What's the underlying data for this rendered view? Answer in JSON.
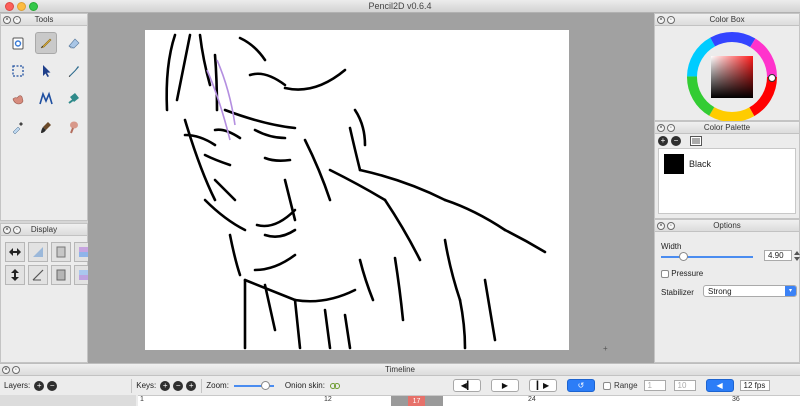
{
  "window": {
    "title": "Pencil2D v0.6.4"
  },
  "tools": {
    "title": "Tools",
    "items": [
      {
        "name": "clear-icon"
      },
      {
        "name": "pencil-icon"
      },
      {
        "name": "eraser-icon"
      },
      {
        "name": "select-icon"
      },
      {
        "name": "pointer-icon"
      },
      {
        "name": "pen-icon"
      },
      {
        "name": "hand-icon"
      },
      {
        "name": "polyline-icon"
      },
      {
        "name": "bucket-icon"
      },
      {
        "name": "eyedropper-icon"
      },
      {
        "name": "brush-icon"
      },
      {
        "name": "smudge-icon"
      }
    ],
    "active": "pencil-icon"
  },
  "display": {
    "title": "Display"
  },
  "colorbox": {
    "title": "Color Box"
  },
  "palette": {
    "title": "Color Palette",
    "colors": [
      {
        "name": "Black",
        "hex": "#000000"
      }
    ]
  },
  "options": {
    "title": "Options",
    "width_label": "Width",
    "width_value": "4.90",
    "pressure_label": "Pressure",
    "stabilizer_label": "Stabilizer",
    "stabilizer_value": "Strong"
  },
  "timeline": {
    "title": "Timeline",
    "layers_label": "Layers:",
    "keys_label": "Keys:",
    "zoom_label": "Zoom:",
    "onion_label": "Onion skin:",
    "range_label": "Range",
    "range_start": "1",
    "range_end": "10",
    "fps": "12 fps",
    "current_frame": "17",
    "ruler_ticks": [
      "1",
      "12",
      "24",
      "36"
    ]
  },
  "colors": {
    "accent": "#2c7df7",
    "playhead": "#e6716a",
    "panel": "#ececec",
    "canvas_bg": "#a1a1a1"
  }
}
